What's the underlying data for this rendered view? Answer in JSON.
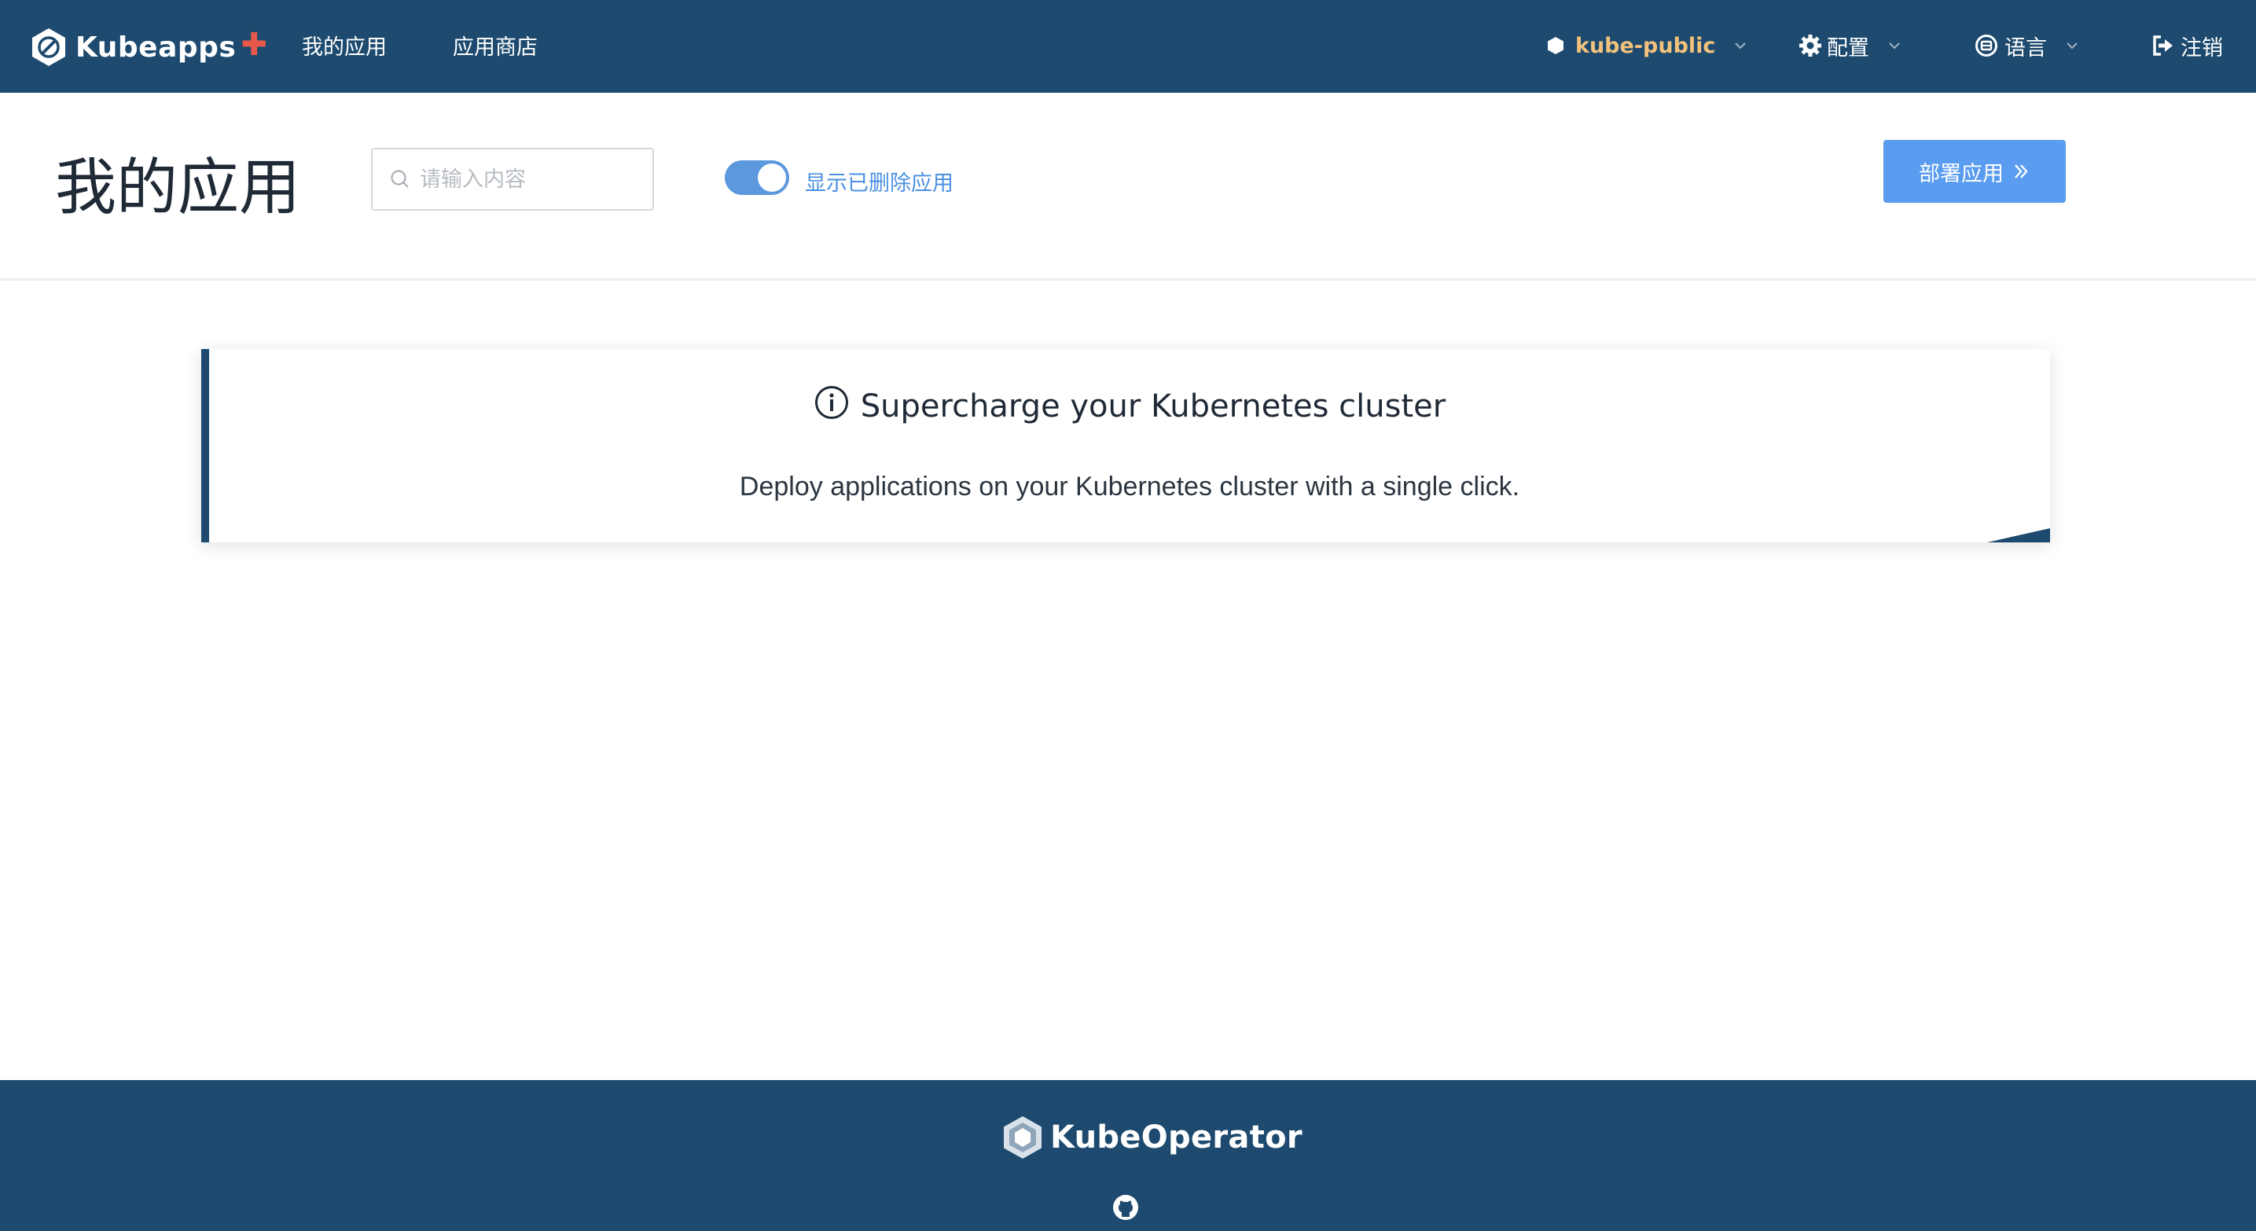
{
  "header": {
    "brand": "Kubeapps",
    "brand_plus": "✚",
    "nav": [
      "我的应用",
      "应用商店"
    ],
    "namespace": "kube-public",
    "settings": "配置",
    "language": "语言",
    "logout": "注销"
  },
  "toolbar": {
    "title": "我的应用",
    "search_placeholder": "请输入内容",
    "show_deleted_label": "显示已删除应用",
    "show_deleted": true,
    "deploy_label": "部署应用"
  },
  "info_card": {
    "title": "Supercharge your Kubernetes cluster",
    "text": "Deploy applications on your Kubernetes cluster with a single click."
  },
  "footer": {
    "brand": "KubeOperator"
  },
  "colors": {
    "header_bg": "#1d4a6e",
    "namespace": "#f2c27d",
    "accent": "#5a9cf0",
    "plus": "#e8584a"
  },
  "icons": [
    "kubeapps-logo-icon",
    "cube-icon",
    "gear-icon",
    "language-icon",
    "logout-icon",
    "chevron-down-icon",
    "search-icon",
    "double-chevron-right-icon",
    "info-icon",
    "kubeoperator-logo-icon",
    "github-icon"
  ]
}
